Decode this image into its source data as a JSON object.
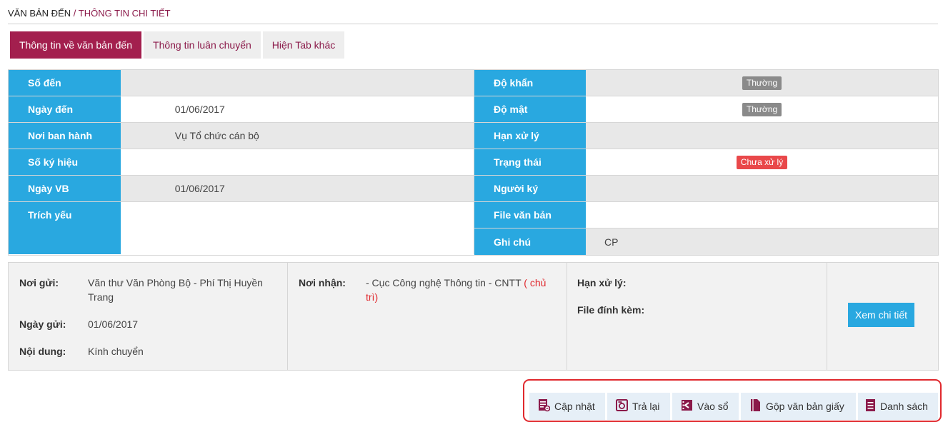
{
  "breadcrumb": {
    "root": "VĂN BẢN ĐẾN",
    "separator": "/",
    "current": "THÔNG TIN CHI TIẾT"
  },
  "tabs": [
    {
      "label": "Thông tin về văn bản đến",
      "active": true
    },
    {
      "label": "Thông tin luân chuyển",
      "active": false
    },
    {
      "label": "Hiện Tab khác",
      "active": false
    }
  ],
  "details_left": [
    {
      "label": "Số đến",
      "value": ""
    },
    {
      "label": "Ngày đến",
      "value": "01/06/2017"
    },
    {
      "label": "Nơi ban hành",
      "value": "Vụ Tổ chức cán bộ"
    },
    {
      "label": "Số ký hiệu",
      "value": ""
    },
    {
      "label": "Ngày VB",
      "value": "01/06/2017"
    },
    {
      "label": "Trích yếu",
      "value": ""
    }
  ],
  "details_right": [
    {
      "label": "Độ khẩn",
      "value": "Thường"
    },
    {
      "label": "Độ mật",
      "value": "Thường"
    },
    {
      "label": "Hạn xử lý",
      "value": ""
    },
    {
      "label": "Trạng thái",
      "value": "Chưa xử lý"
    },
    {
      "label": "Người ký",
      "value": ""
    },
    {
      "label": "File văn bản",
      "value": ""
    },
    {
      "label": "Ghi chú",
      "value": "CP"
    }
  ],
  "colors": {
    "brand": "#a31f4e",
    "label_bg": "#29a8e0",
    "status_red": "#e9484a",
    "badge_gray": "#8a8a8a"
  },
  "send_info": {
    "noi_gui_label": "Nơi gửi:",
    "noi_gui_value": "Văn thư Văn Phòng Bộ - Phí Thị Huyền Trang",
    "ngay_gui_label": "Ngày gửi:",
    "ngay_gui_value": "01/06/2017",
    "noi_dung_label": "Nội dung:",
    "noi_dung_value": "Kính chuyển",
    "noi_nhan_label": "Nơi nhận:",
    "noi_nhan_value": "- Cục Công nghệ Thông tin - CNTT",
    "noi_nhan_role": "( chủ trì)",
    "han_xu_ly_label": "Hạn xử lý:",
    "file_dinh_kem_label": "File đính kèm:",
    "detail_button": "Xem chi tiết"
  },
  "actions": [
    {
      "label": "Cập nhật",
      "icon": "edit-document-icon"
    },
    {
      "label": "Trả lại",
      "icon": "return-icon"
    },
    {
      "label": "Vào sổ",
      "icon": "enter-book-icon"
    },
    {
      "label": "Gộp văn bản giấy",
      "icon": "paper-document-icon"
    },
    {
      "label": "Danh sách",
      "icon": "list-icon"
    }
  ]
}
